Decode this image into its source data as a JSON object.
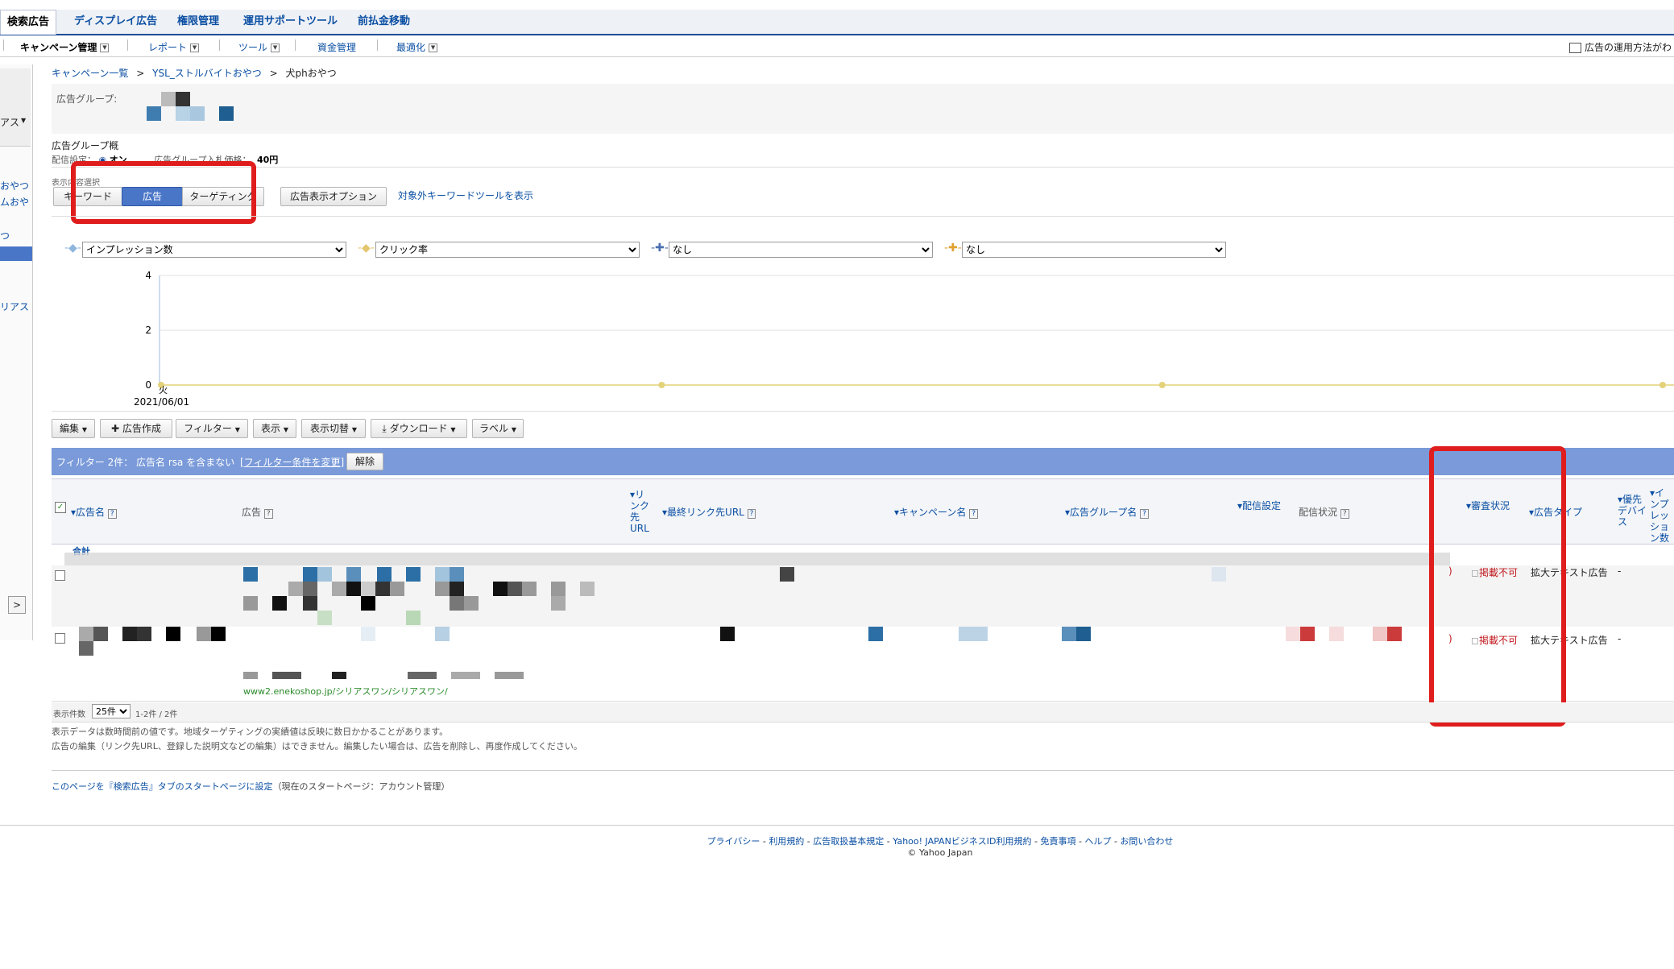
{
  "tabs": [
    {
      "label": "検索広告",
      "active": true
    },
    {
      "label": "ディスプレイ広告"
    },
    {
      "label": "権限管理"
    },
    {
      "label": "運用サポートツール"
    },
    {
      "label": "前払金移動"
    }
  ],
  "subnav": {
    "campaign_mgmt": "キャンペーン管理",
    "report": "レポート",
    "tools": "ツール",
    "funds": "資金管理",
    "optimize": "最適化",
    "help_link": "広告の運用方法がわ"
  },
  "breadcrumb": {
    "root": "キャンペーン一覧",
    "sep": ">",
    "campaign": "YSL_ストルバイトおやつ",
    "current": "犬phおやつ"
  },
  "adgroup": {
    "label": "広告グループ:",
    "summary_label": "広告グループ概",
    "delivery_label": "配信設定：",
    "delivery_value": "オン",
    "bid_label": "広告グループ入札価格：",
    "bid_value": "40円"
  },
  "sidebar": {
    "text1": "アス",
    "items": [
      "おやつ",
      "ムおや",
      "つ",
      "リアス"
    ]
  },
  "view_select": {
    "label": "表示内容選択",
    "keyword": "キーワード",
    "ad": "広告",
    "targeting": "ターゲティング",
    "ad_options": "広告表示オプション",
    "excluded_kw_link": "対象外キーワードツールを表示"
  },
  "metric_selects": [
    "インプレッション数",
    "クリック率",
    "なし",
    "なし"
  ],
  "chart_data": {
    "type": "line",
    "x": [
      "2021/06/01"
    ],
    "x_weekday": "火",
    "series": [
      {
        "values": [
          0,
          0,
          0,
          0
        ]
      }
    ],
    "ylim": [
      0,
      4
    ],
    "yticks": [
      4,
      2,
      0
    ],
    "colors": {
      "series": "#e3d27a"
    }
  },
  "toolbar": {
    "edit": "編集",
    "create_ad": "広告作成",
    "filter": "フィルター",
    "display": "表示",
    "switch": "表示切替",
    "download": "ダウンロード",
    "label": "ラベル"
  },
  "filter_bar": {
    "text": "フィルター 2件： 広告名 rsa を含まない",
    "change_link": "[フィルター条件を変更]",
    "clear": "解除"
  },
  "columns": {
    "ad_name": "広告名",
    "ad": "広告",
    "link_url": "リンク先URL",
    "final_url": "最終リンク先URL",
    "campaign": "キャンペーン名",
    "adgroup": "広告グループ名",
    "delivery": "配信設定",
    "delivery_status": "配信状況",
    "review_status": "審査状況",
    "ad_type": "広告タイプ",
    "device": "優先デバイス",
    "impressions": "インプレッション数"
  },
  "total_row_label": "合計",
  "rows": [
    {
      "review": "掲載不可",
      "type": "拡大テキスト広告",
      "device": "-"
    },
    {
      "review": "掲載不可",
      "type": "拡大テキスト広告",
      "device": "-",
      "url": "www2.enekoshop.jp/シリアスワン/シリアスワン/"
    }
  ],
  "pagination": {
    "label": "表示件数",
    "per_page": "25件",
    "range": "1-2件 / 2件"
  },
  "notes": [
    "表示データは数時間前の値です。地域ターゲティングの実績値は反映に数日かかることがあります。",
    "広告の編集（リンク先URL、登録した説明文などの編集）はできません。編集したい場合は、広告を削除し、再度作成してください。"
  ],
  "startpage": {
    "link": "このページを『検索広告』タブのスタートページに設定",
    "note": "（現在のスタートページ：アカウント管理）"
  },
  "footer": {
    "links": [
      "プライバシー",
      "利用規約",
      "広告取扱基本規定",
      "Yahoo! JAPANビジネスID利用規約",
      "免責事項",
      "ヘルプ",
      "お問い合わせ"
    ],
    "copyright": "© Yahoo Japan"
  },
  "colors": {
    "accent": "#1f4e99",
    "filter_bar": "#7a9ad9",
    "highlight": "#e01d1d",
    "status_red": "#c0161b"
  }
}
